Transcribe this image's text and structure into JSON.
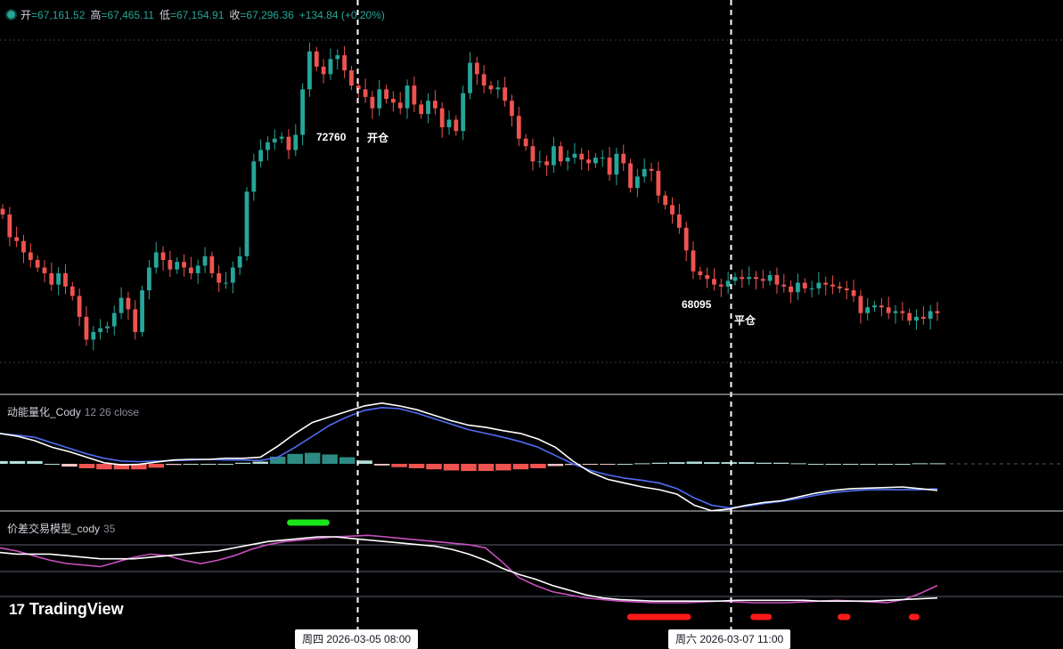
{
  "ohlc": {
    "open_label": "开",
    "open_value": "=67,161.52",
    "high_label": "高",
    "high_value": "=67,465.11",
    "low_label": "低",
    "low_value": "=67,154.91",
    "close_label": "收",
    "close_value": "=67,296.36",
    "change": "+134.84 (+0.20%)"
  },
  "annotations": {
    "open_price": "72760",
    "open_text": "开仓",
    "close_price": "68095",
    "close_text": "平仓"
  },
  "panes": {
    "momentum": {
      "title": "动能量化_Cody",
      "params": "12 26 close"
    },
    "spread": {
      "title": "价差交易模型_cody",
      "params": "35"
    }
  },
  "time_labels": {
    "entry": "周四 2026-03-05   08:00",
    "exit": "周六 2026-03-07   11:00"
  },
  "logo": {
    "mark": "17",
    "text": "TradingView"
  },
  "colors": {
    "up": "#26a69a",
    "down": "#ef5350",
    "macd_line": "#ffffff",
    "signal_line": "#4f6df5",
    "spread_line": "#c850c0",
    "spread_ma": "#ffffff",
    "grid": "#3a3d45",
    "signal_green": "#19e619",
    "signal_red": "#ff1a1a"
  },
  "chart_data": {
    "type": "candlestick",
    "y_price_range": [
      66000,
      74500
    ],
    "price_series": [
      69900,
      69300,
      69200,
      68900,
      68700,
      68500,
      68350,
      68050,
      68350,
      68000,
      67750,
      67200,
      66600,
      66800,
      66900,
      66950,
      67300,
      67700,
      67400,
      66800,
      67900,
      68500,
      68900,
      68700,
      68450,
      68650,
      68500,
      68350,
      68550,
      68800,
      68350,
      68100,
      68100,
      68500,
      68800,
      70500,
      71300,
      71600,
      71800,
      71900,
      71950,
      71600,
      72000,
      73200,
      74200,
      73800,
      73600,
      74000,
      74100,
      73700,
      73300,
      73200,
      73000,
      72700,
      73200,
      72950,
      72850,
      72700,
      73300,
      72800,
      72550,
      72900,
      72700,
      72200,
      72400,
      72100,
      73100,
      73900,
      73600,
      73300,
      73200,
      73250,
      72900,
      72500,
      71900,
      71700,
      71300,
      71300,
      71200,
      71700,
      71300,
      71400,
      71500,
      71350,
      71250,
      71400,
      71400,
      70950,
      71500,
      71250,
      70600,
      70900,
      71100,
      71050,
      70400,
      70150,
      69900,
      69550,
      68950,
      68400,
      68300,
      68200,
      68050,
      68000,
      68150,
      68250,
      68200,
      68250,
      68200,
      68150,
      68300,
      68050,
      68000,
      67850,
      68100,
      67950,
      67950,
      68100,
      68050,
      68000,
      67950,
      67900,
      67750,
      67300,
      67450,
      67500,
      67450,
      67300,
      67350,
      67300,
      67100,
      67200,
      67150,
      67350,
      67296
    ],
    "momentum": {
      "macd_line": [
        0.55,
        0.5,
        0.42,
        0.3,
        0.22,
        0.12,
        0.02,
        -0.02,
        -0.01,
        0.03,
        0.07,
        0.08,
        0.08,
        0.1,
        0.1,
        0.12,
        0.32,
        0.55,
        0.75,
        0.85,
        0.95,
        1.05,
        1.1,
        1.05,
        0.98,
        0.88,
        0.78,
        0.7,
        0.66,
        0.6,
        0.55,
        0.45,
        0.3,
        0.05,
        -0.15,
        -0.28,
        -0.35,
        -0.42,
        -0.47,
        -0.55,
        -0.75,
        -0.85,
        -0.82,
        -0.75,
        -0.7,
        -0.67,
        -0.6,
        -0.53,
        -0.48,
        -0.45,
        -0.44,
        -0.43,
        -0.42,
        -0.45,
        -0.48
      ],
      "signal_line": [
        0.55,
        0.52,
        0.48,
        0.38,
        0.28,
        0.18,
        0.1,
        0.05,
        0.04,
        0.05,
        0.06,
        0.07,
        0.08,
        0.07,
        0.07,
        0.06,
        0.12,
        0.3,
        0.5,
        0.7,
        0.85,
        0.97,
        1.02,
        1.0,
        0.92,
        0.82,
        0.72,
        0.62,
        0.55,
        0.48,
        0.4,
        0.3,
        0.15,
        0.0,
        -0.12,
        -0.2,
        -0.26,
        -0.3,
        -0.35,
        -0.45,
        -0.62,
        -0.75,
        -0.8,
        -0.77,
        -0.72,
        -0.68,
        -0.63,
        -0.57,
        -0.52,
        -0.49,
        -0.47,
        -0.47,
        -0.47,
        -0.47,
        -0.45
      ],
      "histogram": [
        0.05,
        0.05,
        0.05,
        0.0,
        -0.05,
        -0.08,
        -0.1,
        -0.1,
        -0.1,
        -0.07,
        -0.02,
        0.0,
        0.0,
        0.0,
        0.02,
        0.04,
        0.13,
        0.18,
        0.2,
        0.17,
        0.12,
        0.06,
        -0.03,
        -0.06,
        -0.08,
        -0.1,
        -0.12,
        -0.13,
        -0.13,
        -0.12,
        -0.1,
        -0.08,
        -0.04,
        -0.02,
        -0.01,
        -0.01,
        0.0,
        0.01,
        0.02,
        0.03,
        0.04,
        0.03,
        0.03,
        0.03,
        0.02,
        0.02,
        0.01,
        0.0,
        0.0,
        0.0,
        0.0,
        0.0,
        0.0,
        0.01,
        0.01
      ]
    },
    "spread": {
      "spread_line": [
        78,
        74,
        68,
        62,
        58,
        56,
        54,
        60,
        66,
        70,
        68,
        62,
        58,
        62,
        68,
        76,
        82,
        86,
        88,
        90,
        92,
        93,
        94,
        92,
        90,
        88,
        86,
        84,
        82,
        78,
        60,
        40,
        30,
        22,
        18,
        14,
        12,
        10,
        9,
        8,
        8,
        8,
        9,
        10,
        9,
        8,
        8,
        8,
        9,
        10,
        11,
        10,
        9,
        8,
        12,
        20,
        30
      ],
      "spread_ma": [
        72,
        70,
        70,
        70,
        68,
        66,
        64,
        64,
        64,
        66,
        68,
        70,
        72,
        74,
        78,
        82,
        86,
        88,
        90,
        92,
        92,
        90,
        88,
        86,
        84,
        82,
        80,
        76,
        70,
        62,
        52,
        44,
        38,
        30,
        24,
        18,
        14,
        12,
        11,
        10,
        10,
        10,
        10,
        10,
        11,
        11,
        11,
        11,
        11,
        10,
        10,
        10,
        10,
        11,
        12,
        13,
        14
      ],
      "signals": [
        {
          "color": "green",
          "from": 0.27,
          "to": 0.31
        },
        {
          "color": "red",
          "from": 0.59,
          "to": 0.65
        },
        {
          "color": "red",
          "from": 0.706,
          "to": 0.726
        },
        {
          "color": "red",
          "from": 0.788,
          "to": 0.8
        },
        {
          "color": "red",
          "from": 0.855,
          "to": 0.865
        }
      ]
    },
    "events": [
      {
        "label": "开仓",
        "price": 72760,
        "time": "周四 2026-03-05 08:00"
      },
      {
        "label": "平仓",
        "price": 68095,
        "time": "周六 2026-03-07 11:00"
      }
    ]
  }
}
